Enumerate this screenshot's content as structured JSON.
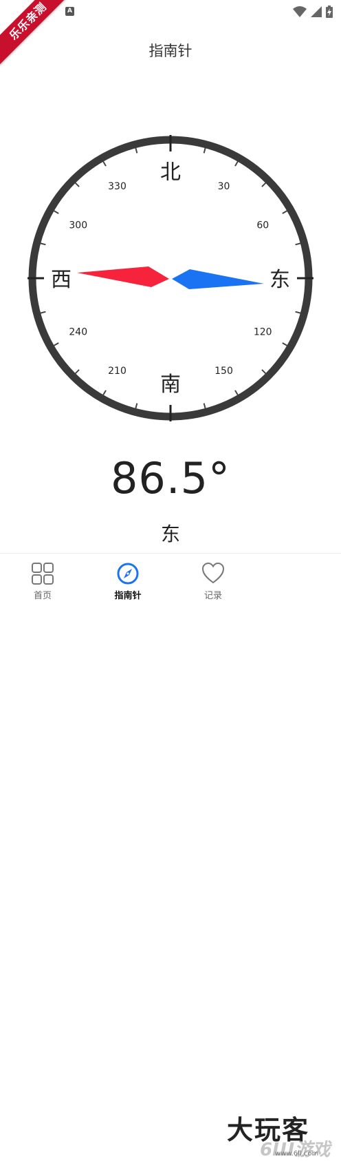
{
  "status_bar": {
    "ribbon_text": "乐乐亲测",
    "notif_icon_letter": "A",
    "icons": [
      "wifi-icon",
      "cell-signal-icon",
      "battery-charging-icon"
    ]
  },
  "header": {
    "title": "指南针"
  },
  "compass": {
    "heading_deg": 86.5,
    "cardinals": {
      "north": "北",
      "east": "东",
      "south": "南",
      "west": "西"
    },
    "degree_labels": [
      "30",
      "60",
      "120",
      "150",
      "210",
      "240",
      "300",
      "330"
    ],
    "degree_values": [
      30,
      60,
      120,
      150,
      210,
      240,
      300,
      330
    ],
    "colors": {
      "ring": "#3a3a3a",
      "west_needle": "#f5243c",
      "east_needle": "#1a73f2"
    }
  },
  "reading": {
    "value": "86.5°",
    "direction": "东"
  },
  "bottom_nav": {
    "items": [
      {
        "label": "首页",
        "icon": "grid-icon",
        "active": false
      },
      {
        "label": "指南针",
        "icon": "compass-icon",
        "active": true
      },
      {
        "label": "记录",
        "icon": "heart-icon",
        "active": false
      }
    ],
    "accent": "#1a73f2"
  },
  "watermark": {
    "text": "大玩客",
    "sub": "6Ш游戏",
    "url": "www.6ll.com"
  }
}
